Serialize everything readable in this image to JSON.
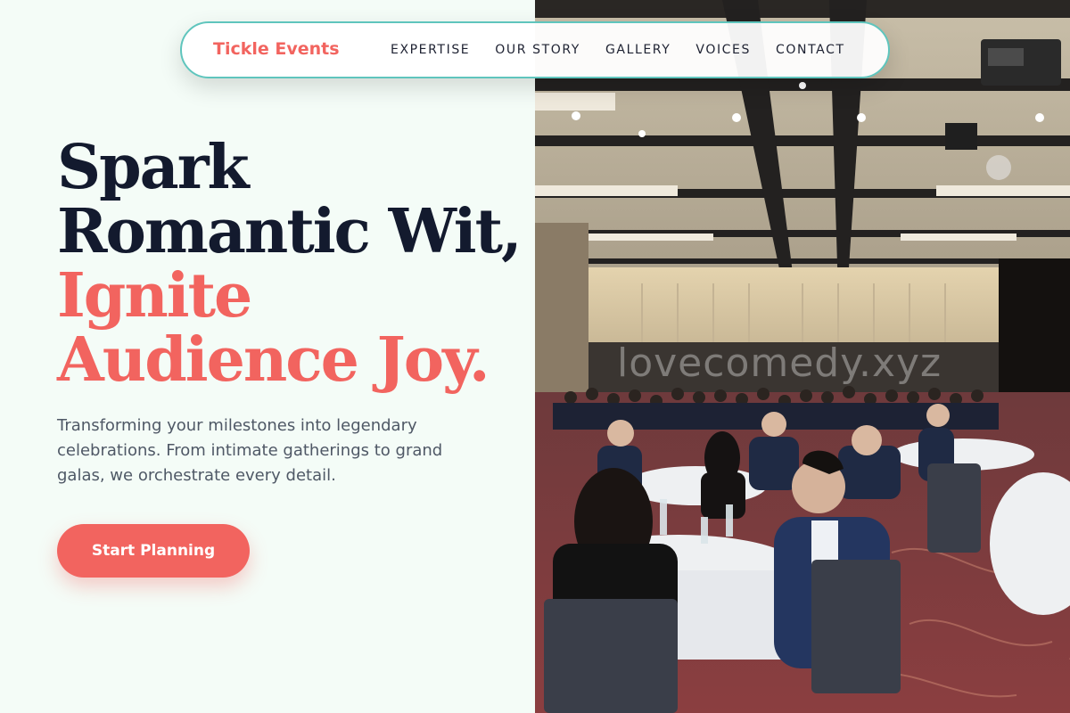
{
  "nav": {
    "brand": "Tickle Events",
    "links": [
      "EXPERTISE",
      "OUR STORY",
      "GALLERY",
      "VOICES",
      "CONTACT"
    ]
  },
  "hero": {
    "headline_line1": "Spark",
    "headline_line2": "Romantic Wit,",
    "headline_line3": "Ignite",
    "headline_line4": "Audience Joy.",
    "subtext": "Transforming your milestones into legendary celebrations. From intimate gatherings to grand galas, we orchestrate every detail.",
    "cta_label": "Start Planning"
  },
  "photo": {
    "description_icon": "banquet-hall-photo",
    "watermark": "lovecomedy.xyz"
  },
  "colors": {
    "accent": "#f2645f",
    "dark": "#131a2e",
    "nav_border": "#5fc5bd",
    "background": "#f4fcf7"
  }
}
